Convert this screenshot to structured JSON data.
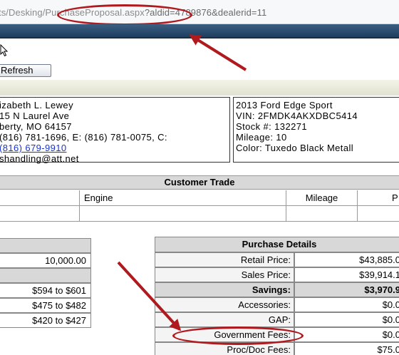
{
  "browser": {
    "url_prefix": "ts/Desking/",
    "url_page": "PurchaseProposal.aspx",
    "url_query": "?aldid=4789876&dealerid=11"
  },
  "toolbar": {
    "refresh_label": "Refresh"
  },
  "customer": {
    "name": "izabeth L. Lewey",
    "street": "15 N Laurel Ave",
    "city": "berty, MO 64157",
    "phones": "(816) 781-1696, E: (816) 781-0075, C:",
    "cell": "(816) 679-9910",
    "email": "shandling@att.net"
  },
  "vehicle": {
    "model": "2013 Ford Edge Sport",
    "vin": "VIN: 2FMDK4AKXDBC5414",
    "stock": "Stock #: 132271",
    "mileage": "Mileage: 10",
    "color": "Color: Tuxedo Black Metall"
  },
  "customer_trade": {
    "title": "Customer Trade",
    "columns": [
      "Engine",
      "Mileage",
      "P"
    ]
  },
  "left_table": {
    "rows": [
      "10,000.00",
      "",
      "$594 to $601",
      "$475 to $482",
      "$420 to $427"
    ]
  },
  "purchase_details": {
    "title": "Purchase Details",
    "rows": [
      {
        "label": "Retail Price:",
        "value": "$43,885.0"
      },
      {
        "label": "Sales Price:",
        "value": "$39,914.1"
      },
      {
        "label": "Savings:",
        "value": "$3,970.9"
      },
      {
        "label": "Accessories:",
        "value": "$0.0"
      },
      {
        "label": "GAP:",
        "value": "$0.0"
      },
      {
        "label": "Government Fees:",
        "value": "$0.0"
      },
      {
        "label": "Proc/Doc Fees:",
        "value": "$75.0"
      }
    ]
  },
  "annotation": {
    "color": "#b0191e"
  }
}
